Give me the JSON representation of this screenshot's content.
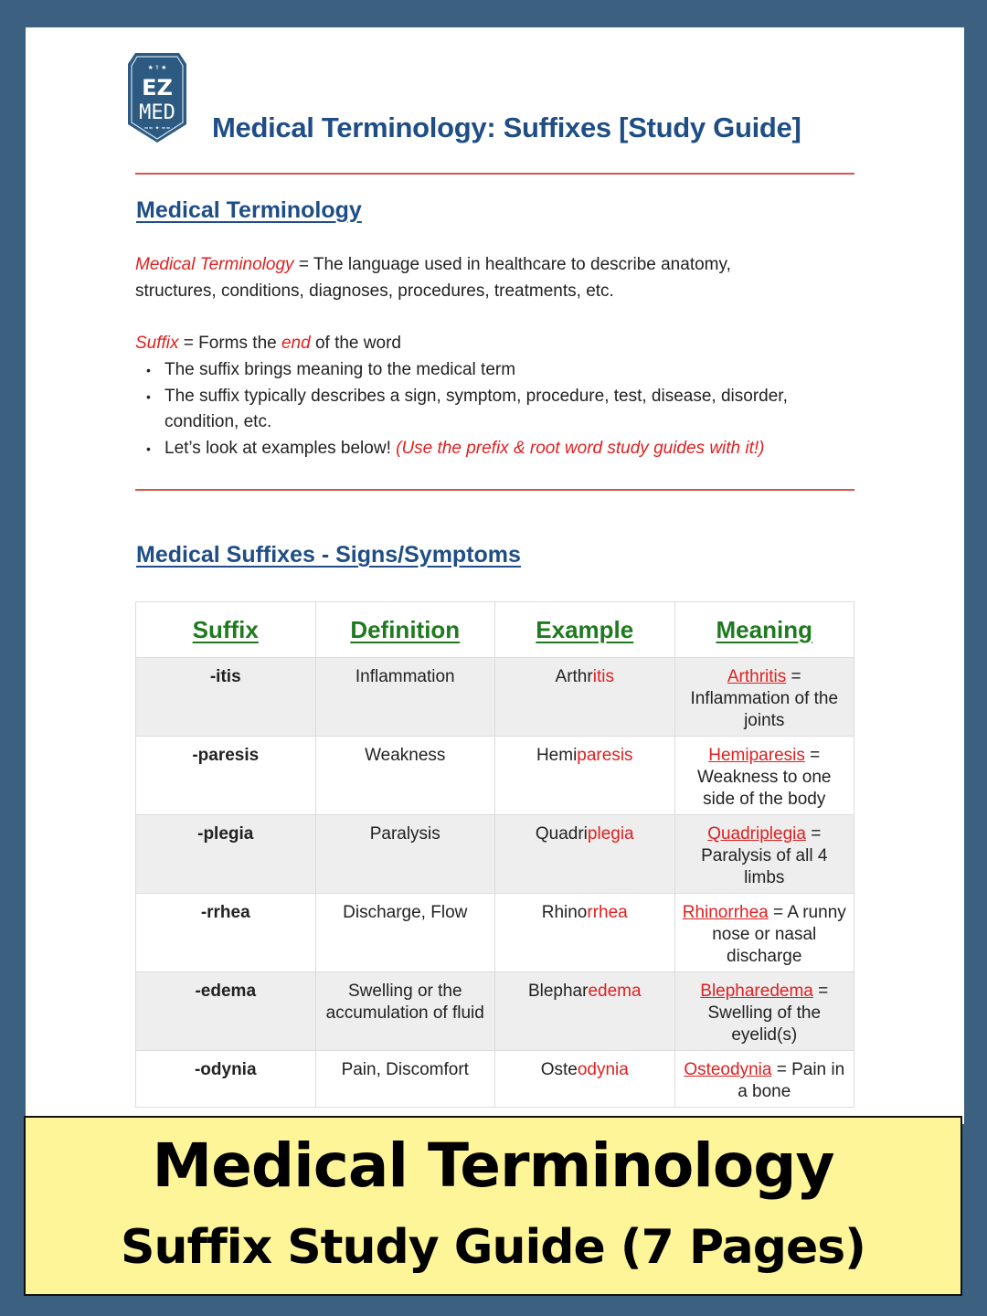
{
  "logo": {
    "line1": "EZ",
    "line2": "MED"
  },
  "document": {
    "title": "Medical Terminology: Suffixes [Study Guide]"
  },
  "intro": {
    "heading": "Medical Terminology",
    "def_term": "Medical Terminology",
    "def_text_line1": " = The language used in healthcare to describe anatomy,",
    "def_text_line2": "structures, conditions, diagnoses, procedures, treatments, etc.",
    "suffix_term": "Suffix",
    "suffix_mid1": " = Forms the ",
    "suffix_end": "end",
    "suffix_mid2": " of the word",
    "bullets": [
      {
        "text": "The suffix brings meaning to the medical term",
        "note": ""
      },
      {
        "text": "The suffix typically describes a sign, symptom, procedure, test, disease, disorder, condition, etc.",
        "note": ""
      },
      {
        "text": "Let’s look at examples below! ",
        "note": "(Use the prefix & root word study guides with it!)"
      }
    ]
  },
  "table_section": {
    "heading": "Medical Suffixes - Signs/Symptoms",
    "headers": [
      "Suffix",
      "Definition",
      "Example",
      "Meaning"
    ],
    "rows": [
      {
        "suffix": "-itis",
        "definition": "Inflammation",
        "example_root": "Arthr",
        "example_suffix": "itis",
        "meaning_term": "Arthritis",
        "meaning_text": " = Inflammation of the joints"
      },
      {
        "suffix": "-paresis",
        "definition": "Weakness",
        "example_root": "Hemi",
        "example_suffix": "paresis",
        "meaning_term": "Hemiparesis",
        "meaning_text": " = Weakness to one side of the body"
      },
      {
        "suffix": "-plegia",
        "definition": "Paralysis",
        "example_root": "Quadri",
        "example_suffix": "plegia",
        "meaning_term": "Quadriplegia",
        "meaning_text": " = Paralysis of all 4 limbs"
      },
      {
        "suffix": "-rrhea",
        "definition": "Discharge, Flow",
        "example_root": "Rhino",
        "example_suffix": "rrhea",
        "meaning_term": "Rhinorrhea",
        "meaning_text": " = A runny nose or nasal discharge"
      },
      {
        "suffix": "-edema",
        "definition": "Swelling or the accumulation of fluid",
        "example_root": "Blephar",
        "example_suffix": "edema",
        "meaning_term": "Blepharedema",
        "meaning_text": " = Swelling of the eyelid(s)"
      },
      {
        "suffix": "-odynia",
        "definition": "Pain, Discomfort",
        "example_root": "Oste",
        "example_suffix": "odynia",
        "meaning_term": "Osteodynia",
        "meaning_text": " = Pain in a bone"
      }
    ]
  },
  "banner": {
    "line1": "Medical Terminology",
    "line2": "Suffix Study Guide (7 Pages)"
  },
  "colors": {
    "background": "#3b6080",
    "brand_blue": "#1f4e86",
    "accent_red": "#e02020",
    "header_green": "#1f7a1f",
    "banner_yellow": "#fef598"
  }
}
